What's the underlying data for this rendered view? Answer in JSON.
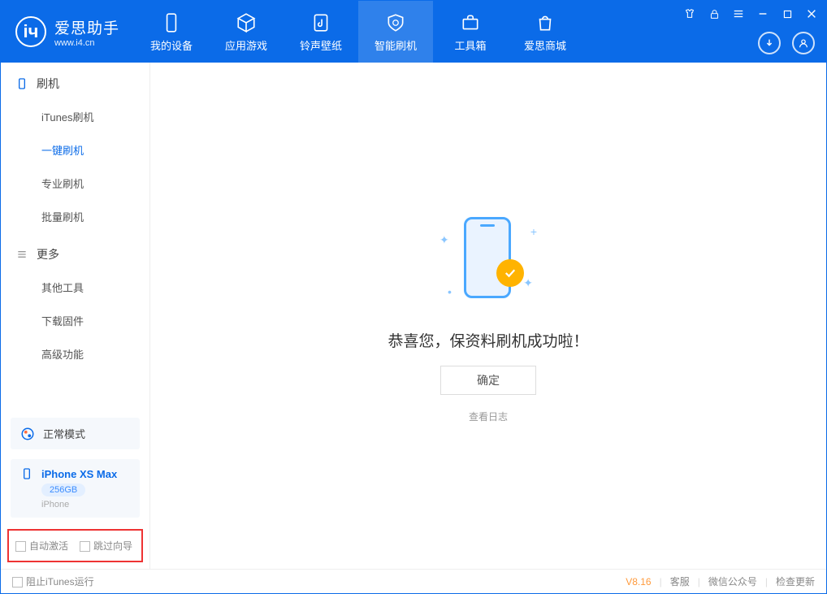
{
  "app": {
    "name_cn": "爱思助手",
    "name_en": "www.i4.cn"
  },
  "nav": {
    "mydevice": "我的设备",
    "apps": "应用游戏",
    "ring": "铃声壁纸",
    "flash": "智能刷机",
    "toolbox": "工具箱",
    "store": "爱思商城"
  },
  "sidebar": {
    "section1": "刷机",
    "items1": [
      "iTunes刷机",
      "一键刷机",
      "专业刷机",
      "批量刷机"
    ],
    "section2": "更多",
    "items2": [
      "其他工具",
      "下载固件",
      "高级功能"
    ]
  },
  "mode": {
    "label": "正常模式"
  },
  "device": {
    "name": "iPhone XS Max",
    "storage": "256GB",
    "type": "iPhone"
  },
  "checks": {
    "auto_activate": "自动激活",
    "skip_guide": "跳过向导"
  },
  "main": {
    "success": "恭喜您，保资料刷机成功啦！",
    "ok": "确定",
    "viewlog": "查看日志"
  },
  "status": {
    "block_itunes": "阻止iTunes运行",
    "version": "V8.16",
    "kefu": "客服",
    "wechat": "微信公众号",
    "update": "检查更新"
  }
}
